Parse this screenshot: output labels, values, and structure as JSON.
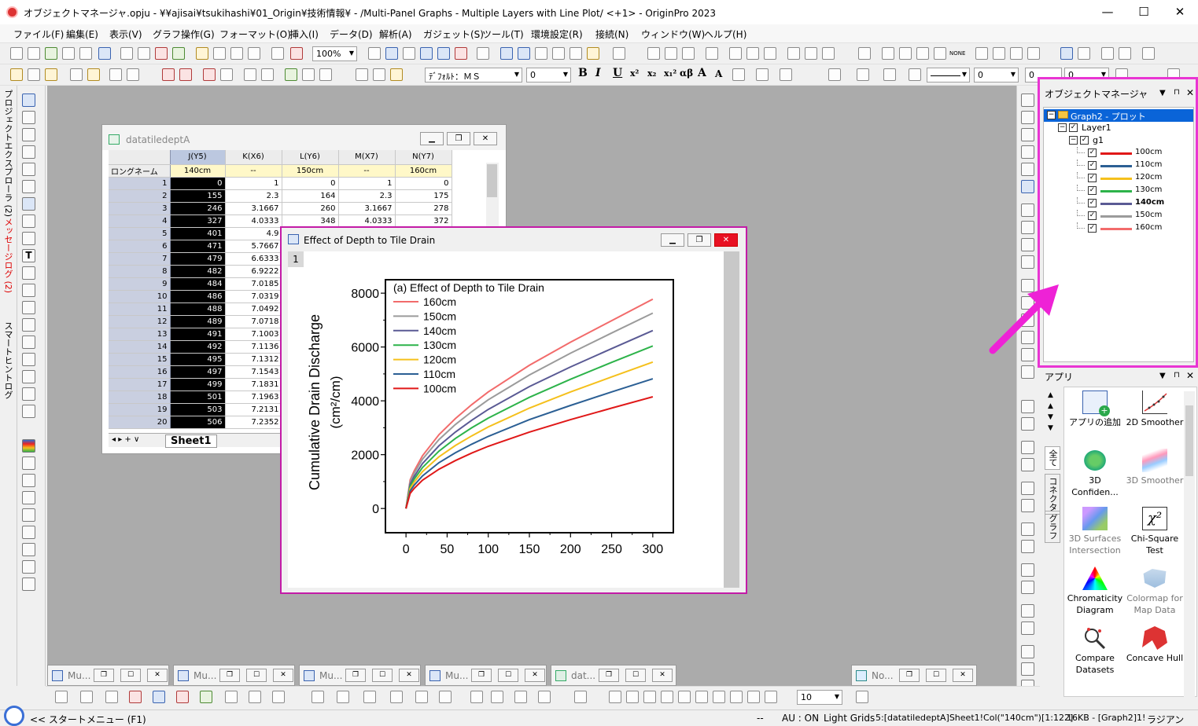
{
  "window": {
    "title": "オブジェクトマネージャ.opju - ¥¥ajisai¥tsukihashi¥01_Origin¥技術情報¥ - /Multi-Panel Graphs - Multiple Layers with Line Plot/ <+1> - OriginPro 2023",
    "minimize": "—",
    "maximize": "☐",
    "close": "✕"
  },
  "menu": [
    "ファイル(F)",
    "編集(E)",
    "表示(V)",
    "グラフ操作(G)",
    "フォーマット(O)",
    "挿入(I)",
    "データ(D)",
    "解析(A)",
    "ガジェット(S)",
    "ツール(T)",
    "環境設定(R)",
    "接続(N)",
    "ウィンドウ(W)",
    "ヘルプ(H)"
  ],
  "toolbar": {
    "zoom": "100%",
    "font": "ﾃﾞﾌｫﾙﾄ：ＭＳ",
    "font_size": "0",
    "bold": "B",
    "italic": "I",
    "underline": "U",
    "superscript": "x²",
    "subscript": "x₂",
    "super_sub": "x₁²",
    "greek": "αβ",
    "grow_font": "A",
    "shrink_font": "A",
    "line_width": "0",
    "angle": "0",
    "pattern": "0",
    "none_label": "NONE"
  },
  "left_tabs": {
    "project_explorer": "プロジェクトエクスプローラ (2)",
    "message_log": "メッセージログ (2)",
    "smart_hint": "スマートヒントログ"
  },
  "worksheet": {
    "title": "datatiledeptA",
    "columns": [
      "J(Y5)",
      "K(X6)",
      "L(Y6)",
      "M(X7)",
      "N(Y7)"
    ],
    "longname_label": "ロングネーム",
    "longnames": [
      "140cm",
      "--",
      "150cm",
      "--",
      "160cm"
    ],
    "rows": [
      [
        "1",
        "0",
        "1",
        "0",
        "1",
        "0"
      ],
      [
        "2",
        "155",
        "2.3",
        "164",
        "2.3",
        "175"
      ],
      [
        "3",
        "246",
        "3.1667",
        "260",
        "3.1667",
        "278"
      ],
      [
        "4",
        "327",
        "4.0333",
        "348",
        "4.0333",
        "372"
      ],
      [
        "5",
        "401",
        "4.9",
        "",
        "",
        ""
      ],
      [
        "6",
        "471",
        "5.7667",
        "",
        "",
        ""
      ],
      [
        "7",
        "479",
        "6.6333",
        "",
        "",
        ""
      ],
      [
        "8",
        "482",
        "6.9222",
        "",
        "",
        ""
      ],
      [
        "9",
        "484",
        "7.0185",
        "",
        "",
        ""
      ],
      [
        "10",
        "486",
        "7.0319",
        "",
        "",
        ""
      ],
      [
        "11",
        "488",
        "7.0492",
        "",
        "",
        ""
      ],
      [
        "12",
        "489",
        "7.0718",
        "",
        "",
        ""
      ],
      [
        "13",
        "491",
        "7.1003",
        "",
        "",
        ""
      ],
      [
        "14",
        "492",
        "7.1136",
        "",
        "",
        ""
      ],
      [
        "15",
        "495",
        "7.1312",
        "",
        "",
        ""
      ],
      [
        "16",
        "497",
        "7.1543",
        "",
        "",
        ""
      ],
      [
        "17",
        "499",
        "7.1831",
        "",
        "",
        ""
      ],
      [
        "18",
        "501",
        "7.1963",
        "",
        "",
        ""
      ],
      [
        "19",
        "503",
        "7.2131",
        "",
        "",
        ""
      ],
      [
        "20",
        "506",
        "7.2352",
        "",
        "",
        ""
      ]
    ],
    "sheet_tab": "Sheet1"
  },
  "graph": {
    "title": "Effect of Depth to Tile Drain",
    "layer_label": "1"
  },
  "chart_data": {
    "type": "line",
    "title": "(a) Effect of Depth to Tile Drain",
    "ylabel_line1": "Cumulative Drain Discharge",
    "ylabel_line2": "(cm²/cm)",
    "xlabel": "",
    "xlim": [
      -25,
      325
    ],
    "ylim": [
      -900,
      8500
    ],
    "xticks": [
      0,
      50,
      100,
      150,
      200,
      250,
      300
    ],
    "yticks": [
      0,
      2000,
      4000,
      6000,
      8000
    ],
    "grid": false,
    "legend": "top-left",
    "x": [
      0,
      5,
      10,
      20,
      40,
      60,
      80,
      100,
      150,
      200,
      250,
      300
    ],
    "series": [
      {
        "name": "160cm",
        "color": "#f26b6b",
        "values": [
          0,
          1060,
          1400,
          1960,
          2740,
          3340,
          3860,
          4330,
          5320,
          6180,
          6980,
          7780
        ]
      },
      {
        "name": "150cm",
        "color": "#9b9b9b",
        "values": [
          0,
          990,
          1310,
          1830,
          2560,
          3120,
          3600,
          4040,
          4960,
          5770,
          6520,
          7260
        ]
      },
      {
        "name": "140cm",
        "color": "#5a5a94",
        "values": [
          0,
          900,
          1190,
          1670,
          2330,
          2840,
          3280,
          3680,
          4530,
          5260,
          5940,
          6610
        ]
      },
      {
        "name": "130cm",
        "color": "#2db34a",
        "values": [
          0,
          820,
          1090,
          1520,
          2130,
          2600,
          3000,
          3360,
          4130,
          4800,
          5430,
          6040
        ]
      },
      {
        "name": "120cm",
        "color": "#f5c01c",
        "values": [
          0,
          740,
          980,
          1370,
          1920,
          2340,
          2700,
          3030,
          3730,
          4330,
          4890,
          5440
        ]
      },
      {
        "name": "110cm",
        "color": "#2b5f94",
        "values": [
          0,
          650,
          870,
          1210,
          1700,
          2070,
          2390,
          2680,
          3300,
          3830,
          4330,
          4820
        ]
      },
      {
        "name": "100cm",
        "color": "#e01818",
        "values": [
          0,
          560,
          750,
          1050,
          1460,
          1780,
          2060,
          2310,
          2840,
          3300,
          3730,
          4150
        ]
      }
    ]
  },
  "object_manager": {
    "title": "オブジェクトマネージャ",
    "graph_node": "Graph2 - プロット",
    "layer_node": "Layer1",
    "group_node": "g1",
    "plots": [
      {
        "label": "100cm",
        "color": "#e01818"
      },
      {
        "label": "110cm",
        "color": "#2b5f94"
      },
      {
        "label": "120cm",
        "color": "#f5c01c"
      },
      {
        "label": "130cm",
        "color": "#2db34a"
      },
      {
        "label": "140cm",
        "color": "#5a5a94"
      },
      {
        "label": "150cm",
        "color": "#9b9b9b"
      },
      {
        "label": "160cm",
        "color": "#f26b6b"
      }
    ],
    "active_plot": "140cm"
  },
  "apps": {
    "title": "アプリ",
    "tabs": [
      "全て",
      "コネクタ",
      "グラフ"
    ],
    "items": [
      {
        "line1": "アプリの追加",
        "line2": ""
      },
      {
        "line1": "2D Smoother",
        "line2": ""
      },
      {
        "line1": "3D",
        "line2": "Confiden..."
      },
      {
        "line1": "3D Smoother",
        "line2": ""
      },
      {
        "line1": "3D Surfaces",
        "line2": "Intersection"
      },
      {
        "line1": "Chi-Square",
        "line2": "Test"
      },
      {
        "line1": "Chromaticity",
        "line2": "Diagram"
      },
      {
        "line1": "Colormap for",
        "line2": "Map Data"
      },
      {
        "line1": "Compare",
        "line2": "Datasets"
      },
      {
        "line1": "Concave Hull",
        "line2": ""
      }
    ]
  },
  "minimized_windows": [
    "Mu...",
    "Mu...",
    "Mu...",
    "Mu...",
    "dat...",
    "No..."
  ],
  "bottom_toolbar": {
    "size_value": "10"
  },
  "status": {
    "start_menu": "<< スタートメニュー (F1)",
    "dashes": "--",
    "au": "AU : ON",
    "grids": "Light Grids",
    "cell": "5:[datatiledeptA]Sheet1!Col(\"140cm\")[1:122]",
    "size": "16KB - [Graph2]1!",
    "unit": "ラジアン"
  },
  "colors": {
    "highlight": "#e935d3",
    "graph_border": "#c31ba7"
  }
}
